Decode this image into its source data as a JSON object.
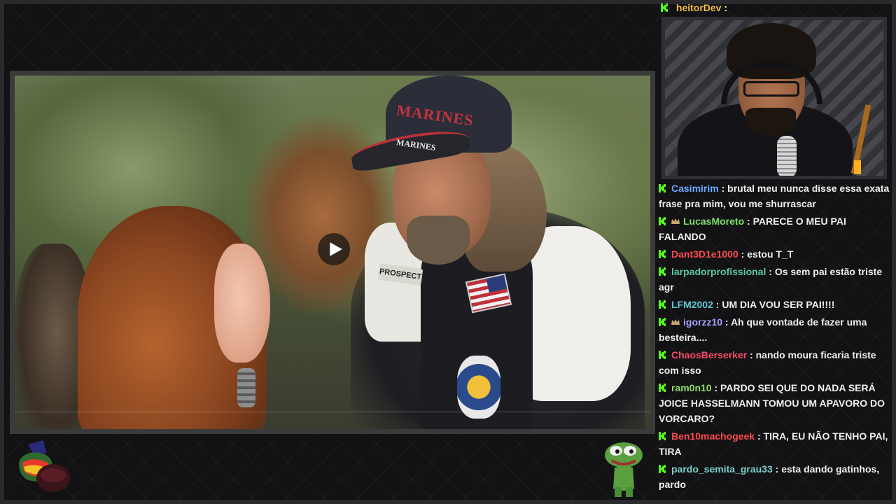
{
  "video": {
    "cap_text": "MARINES",
    "brim_text": "MARINES",
    "patch_text": "PROSPECT"
  },
  "chat_top": {
    "user": "heitorDev",
    "user_color": "#f0c040",
    "sep": ":"
  },
  "chat": {
    "messages": [
      {
        "user": "Casimirim",
        "color": "#6aa8ff",
        "sub": false,
        "text": "brutal meu nunca disse essa exata frase pra mim, vou me shurrascar"
      },
      {
        "user": "LucasMoreto",
        "color": "#7fe06a",
        "sub": true,
        "text": "PARECE O MEU PAI FALANDO"
      },
      {
        "user": "Dant3D1e1000",
        "color": "#ff4a4a",
        "sub": false,
        "text": "estou T_T"
      },
      {
        "user": "larpadorprofissional",
        "color": "#5cc8a0",
        "sub": false,
        "text": "Os sem pai estão triste agr"
      },
      {
        "user": "LFM2002",
        "color": "#5cc8d8",
        "sub": false,
        "text": "UM DIA VOU SER PAI!!!!"
      },
      {
        "user": "igorzz10",
        "color": "#a8a0ff",
        "sub": true,
        "text": "Ah que vontade de fazer uma besteira...."
      },
      {
        "user": "ChaosBerserker",
        "color": "#ff4a6a",
        "sub": false,
        "text": "nando moura ficaria triste com isso"
      },
      {
        "user": "ram0n10",
        "color": "#8ae068",
        "sub": false,
        "text": "PARDO SEI QUE DO NADA SERÁ JOICE HASSELMANN TOMOU UM APAVORO DO VORCARO?"
      },
      {
        "user": "Ben10machogeek",
        "color": "#ff4a4a",
        "sub": false,
        "text": "TIRA, EU NÃO TENHO PAI, TIRA"
      },
      {
        "user": "pardo_semita_grau33",
        "color": "#7fd0c8",
        "sub": false,
        "text": "esta dando gatinhos, pardo"
      }
    ]
  },
  "colors": {
    "kick_green": "#53fc18",
    "frame": "#2a2a2c"
  }
}
